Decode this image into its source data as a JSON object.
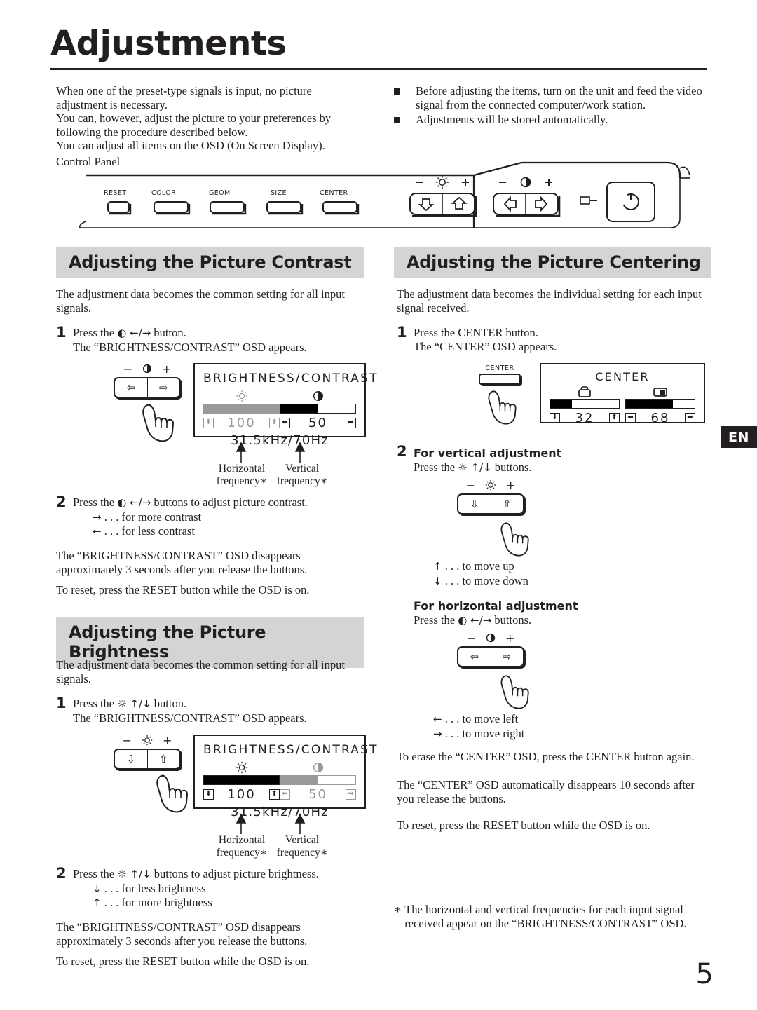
{
  "page": {
    "title": "Adjustments",
    "page_number": "5",
    "lang_tab": "EN"
  },
  "intro": {
    "left_paragraphs": [
      "When one of the preset-type signals is input, no picture adjustment is necessary.",
      "You can, however, adjust the picture to your preferences by following the procedure described below.",
      "You can adjust all items on the OSD (On Screen Display)."
    ],
    "right_bullets": [
      "Before adjusting the items, turn on the unit and feed the video signal from the connected computer/work station.",
      "Adjustments will be stored automatically."
    ],
    "control_panel_label": "Control Panel"
  },
  "control_panel": {
    "buttons": [
      "RESET",
      "COLOR",
      "GEOM",
      "SIZE",
      "CENTER"
    ],
    "brightness_group": {
      "minus": "−",
      "icon": "brightness-sun-icon",
      "plus": "+",
      "left_key": "⇩",
      "right_key": "⇧"
    },
    "contrast_group": {
      "minus": "−",
      "icon": "contrast-halfcircle-icon",
      "plus": "+",
      "left_key": "⇦",
      "right_key": "⇨"
    },
    "power": {
      "indicator": "power-indicator-icon",
      "symbol": "⏻"
    }
  },
  "sections": {
    "contrast": {
      "heading": "Adjusting the Picture Contrast",
      "intro": "The adjustment data becomes the common setting for all input signals.",
      "step1": {
        "num": "1",
        "line1_pre": "Press the ",
        "line1_sym": "◐ ←/→",
        "line1_post": " button.",
        "line2": "The “BRIGHTNESS/CONTRAST” OSD appears."
      },
      "osd": {
        "title": "BRIGHTNESS/CONTRAST",
        "frequency": "31.5kHz/70Hz",
        "brightness": {
          "icon": "brightness-sun-icon",
          "value": "100",
          "fill_percent": 100,
          "active": false
        },
        "contrast": {
          "icon": "contrast-halfcircle-icon",
          "value": "50",
          "fill_percent": 50,
          "active": true
        },
        "callout_left_l1": "Horizontal",
        "callout_left_l2": "frequency∗",
        "callout_right_l1": "Vertical",
        "callout_right_l2": "frequency∗"
      },
      "step2": {
        "num": "2",
        "line1_pre": "Press the ",
        "line1_sym": "◐ ←/→",
        "line1_post": " buttons to adjust picture contrast.",
        "sub1_sym": "→",
        "sub1": ". . . for more contrast",
        "sub2_sym": "←",
        "sub2": ". . . for less contrast"
      },
      "note1": "The “BRIGHTNESS/CONTRAST” OSD disappears approximately 3 seconds after you release the buttons.",
      "note2": "To reset, press the RESET button while the OSD is on."
    },
    "brightness": {
      "heading": "Adjusting the Picture Brightness",
      "intro": "The adjustment data becomes the common setting for all input signals.",
      "step1": {
        "num": "1",
        "line1_pre": "Press the ",
        "line1_sym": "☼ ↑/↓",
        "line1_post": " button.",
        "line2": "The “BRIGHTNESS/CONTRAST” OSD appears."
      },
      "osd": {
        "title": "BRIGHTNESS/CONTRAST",
        "frequency": "31.5kHz/70Hz",
        "brightness": {
          "icon": "brightness-sun-icon",
          "value": "100",
          "fill_percent": 100,
          "active": true
        },
        "contrast": {
          "icon": "contrast-halfcircle-icon",
          "value": "50",
          "fill_percent": 50,
          "active": false
        },
        "callout_left_l1": "Horizontal",
        "callout_left_l2": "frequency∗",
        "callout_right_l1": "Vertical",
        "callout_right_l2": "frequency∗"
      },
      "step2": {
        "num": "2",
        "line1_pre": "Press the ",
        "line1_sym": "☼ ↑/↓",
        "line1_post": " buttons to adjust picture brightness.",
        "sub1_sym": "↓",
        "sub1": ". . . for less brightness",
        "sub2_sym": "↑",
        "sub2": ". . . for more brightness"
      },
      "note1": "The “BRIGHTNESS/CONTRAST” OSD disappears  approximately 3 seconds after you release the buttons.",
      "note2": "To reset, press the RESET button while the OSD is on."
    },
    "centering": {
      "heading": "Adjusting the Picture Centering",
      "intro": "The adjustment data becomes the individual setting for each input signal received.",
      "step1": {
        "num": "1",
        "line1": "Press the CENTER button.",
        "line2": "The “CENTER” OSD appears."
      },
      "center_button_label": "CENTER",
      "osd": {
        "title": "CENTER",
        "vertical": {
          "icon": "center-vertical-icon",
          "value": "32",
          "fill_percent": 32
        },
        "horizontal": {
          "icon": "center-horizontal-icon",
          "value": "68",
          "fill_percent": 68
        }
      },
      "step2": {
        "num": "2",
        "heading": "For vertical adjustment",
        "line_pre": "Press the ",
        "line_sym": "☼ ↑/↓",
        "line_post": " buttons.",
        "legend_minus": "−",
        "legend_icon": "brightness-sun-icon",
        "legend_plus": "+",
        "key_left": "⇩",
        "key_right": "⇧",
        "sub1_sym": "↑",
        "sub1": ". . . to move up",
        "sub2_sym": "↓",
        "sub2": ". . . to move down"
      },
      "step3": {
        "heading": "For horizontal adjustment",
        "line_pre": "Press the ",
        "line_sym": "◐ ←/→",
        "line_post": " buttons.",
        "legend_minus": "−",
        "legend_icon": "contrast-halfcircle-icon",
        "legend_plus": "+",
        "key_left": "⇦",
        "key_right": "⇨",
        "sub1_sym": "←",
        "sub1": ". . . to move left",
        "sub2_sym": "→",
        "sub2": ". . . to move right"
      },
      "note1": "To erase the “CENTER” OSD, press the CENTER button again.",
      "note2": "The “CENTER” OSD automatically disappears 10 seconds after you release the buttons.",
      "note3": "To reset, press the RESET button while the OSD is on."
    }
  },
  "footnote": {
    "marker": "∗",
    "text": "The horizontal and vertical frequencies for each input signal received appear on the “BRIGHTNESS/CONTRAST” OSD."
  }
}
